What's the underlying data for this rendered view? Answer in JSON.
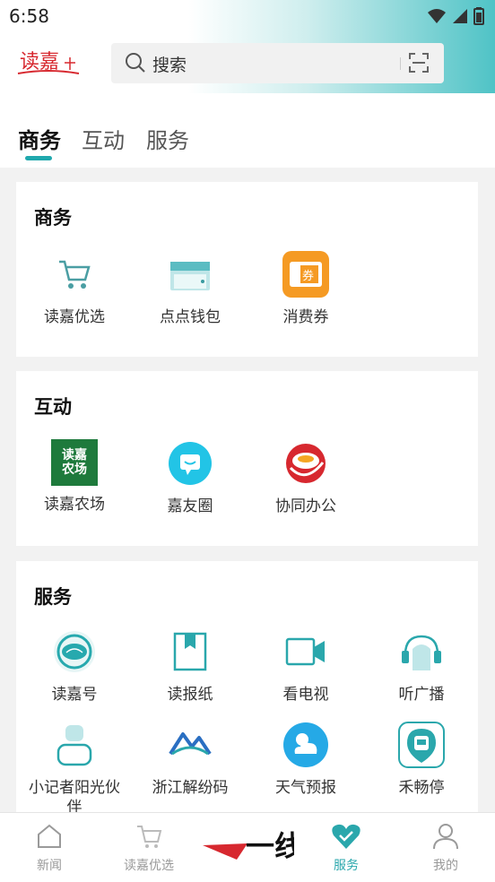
{
  "status_bar": {
    "time": "6:58"
  },
  "header": {
    "logo_text": "读嘉",
    "search_placeholder": "搜索"
  },
  "tabs": [
    {
      "label": "商务",
      "active": true
    },
    {
      "label": "互动",
      "active": false
    },
    {
      "label": "服务",
      "active": false
    }
  ],
  "sections": {
    "commerce": {
      "title": "商务",
      "items": [
        {
          "label": "读嘉优选",
          "icon": "shopping-cart-icon"
        },
        {
          "label": "点点钱包",
          "icon": "wallet-icon"
        },
        {
          "label": "消费券",
          "icon": "coupon-icon"
        }
      ]
    },
    "interaction": {
      "title": "互动",
      "items": [
        {
          "label": "读嘉农场",
          "icon": "farm-icon",
          "icon_text": "读嘉农场"
        },
        {
          "label": "嘉友圈",
          "icon": "chat-bubble-icon"
        },
        {
          "label": "协同办公",
          "icon": "office-logo-icon"
        }
      ]
    },
    "services": {
      "title": "服务",
      "items": [
        {
          "label": "读嘉号",
          "icon": "dujia-seal-icon"
        },
        {
          "label": "读报纸",
          "icon": "newspaper-bookmark-icon"
        },
        {
          "label": "看电视",
          "icon": "video-camera-icon"
        },
        {
          "label": "听广播",
          "icon": "headphones-icon"
        },
        {
          "label": "小记者阳光伙伴",
          "icon": "person-badge-icon"
        },
        {
          "label": "浙江解纷码",
          "icon": "mediation-code-icon"
        },
        {
          "label": "天气预报",
          "icon": "weather-icon"
        },
        {
          "label": "禾畅停",
          "icon": "parking-icon"
        }
      ]
    }
  },
  "bottom_nav": {
    "items": [
      {
        "label": "新闻",
        "icon": "home-icon"
      },
      {
        "label": "读嘉优选",
        "icon": "cart-icon"
      },
      {
        "label": "",
        "icon": "yixian-logo-icon",
        "logo_text": "一线"
      },
      {
        "label": "服务",
        "icon": "heart-check-icon",
        "active": true
      },
      {
        "label": "我的",
        "icon": "user-icon"
      }
    ]
  },
  "colors": {
    "accent": "#1fa8ad",
    "coupon_orange": "#f59a23",
    "farm_green": "#1e7a3c",
    "chat_cyan": "#22c4e6",
    "logo_red": "#d7282f"
  }
}
